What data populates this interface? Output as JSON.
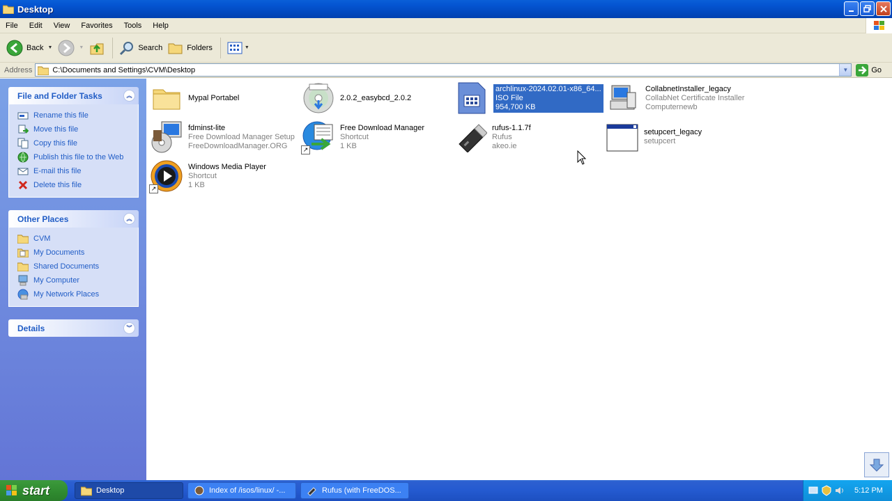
{
  "window": {
    "title": "Desktop"
  },
  "menu": [
    "File",
    "Edit",
    "View",
    "Favorites",
    "Tools",
    "Help"
  ],
  "toolbar": {
    "back": "Back",
    "search": "Search",
    "folders": "Folders"
  },
  "address": {
    "label": "Address",
    "path": "C:\\Documents and Settings\\CVM\\Desktop",
    "go": "Go"
  },
  "tasks": {
    "title": "File and Folder Tasks",
    "items": [
      {
        "label": "Rename this file",
        "icon": "rename-icon"
      },
      {
        "label": "Move this file",
        "icon": "move-icon"
      },
      {
        "label": "Copy this file",
        "icon": "copy-icon"
      },
      {
        "label": "Publish this file to the Web",
        "icon": "publish-icon"
      },
      {
        "label": "E-mail this file",
        "icon": "email-icon"
      },
      {
        "label": "Delete this file",
        "icon": "delete-icon"
      }
    ]
  },
  "places": {
    "title": "Other Places",
    "items": [
      {
        "label": "CVM",
        "icon": "folder-icon"
      },
      {
        "label": "My Documents",
        "icon": "my-documents-icon"
      },
      {
        "label": "Shared Documents",
        "icon": "shared-documents-icon"
      },
      {
        "label": "My Computer",
        "icon": "my-computer-icon"
      },
      {
        "label": "My Network Places",
        "icon": "network-places-icon"
      }
    ]
  },
  "details": {
    "title": "Details"
  },
  "files": [
    {
      "name": "Mypal Portabel",
      "line2": "",
      "line3": "",
      "icon": "folder-icon"
    },
    {
      "name": "2.0.2_easybcd_2.0.2",
      "line2": "",
      "line3": "",
      "icon": "disc-image-icon"
    },
    {
      "name": "archlinux-2024.02.01-x86_64...",
      "line2": "ISO File",
      "line3": "954,700 KB",
      "icon": "iso-file-icon"
    },
    {
      "name": "CollabnetInstaller_legacy",
      "line2": "CollabNet Certificate Installer",
      "line3": "Computernewb",
      "icon": "installer-icon"
    },
    {
      "name": "fdminst-lite",
      "line2": "Free Download Manager Setup",
      "line3": "FreeDownloadManager.ORG",
      "icon": "setup-icon"
    },
    {
      "name": "Free Download Manager",
      "line2": "Shortcut",
      "line3": "1 KB",
      "icon": "fdm-shortcut-icon"
    },
    {
      "name": "rufus-1.1.7f",
      "line2": "Rufus",
      "line3": "akeo.ie",
      "icon": "usb-drive-icon"
    },
    {
      "name": "setupcert_legacy",
      "line2": "setupcert",
      "line3": "",
      "icon": "app-window-icon"
    },
    {
      "name": "Windows Media Player",
      "line2": "Shortcut",
      "line3": "1 KB",
      "icon": "media-player-icon"
    }
  ],
  "taskbar": {
    "start": "start",
    "items": [
      {
        "label": "Desktop",
        "active": true
      },
      {
        "label": "Index of /isos/linux/ -...",
        "active": false
      },
      {
        "label": "Rufus (with FreeDOS...",
        "active": false
      }
    ],
    "clock": "5:12 PM"
  }
}
